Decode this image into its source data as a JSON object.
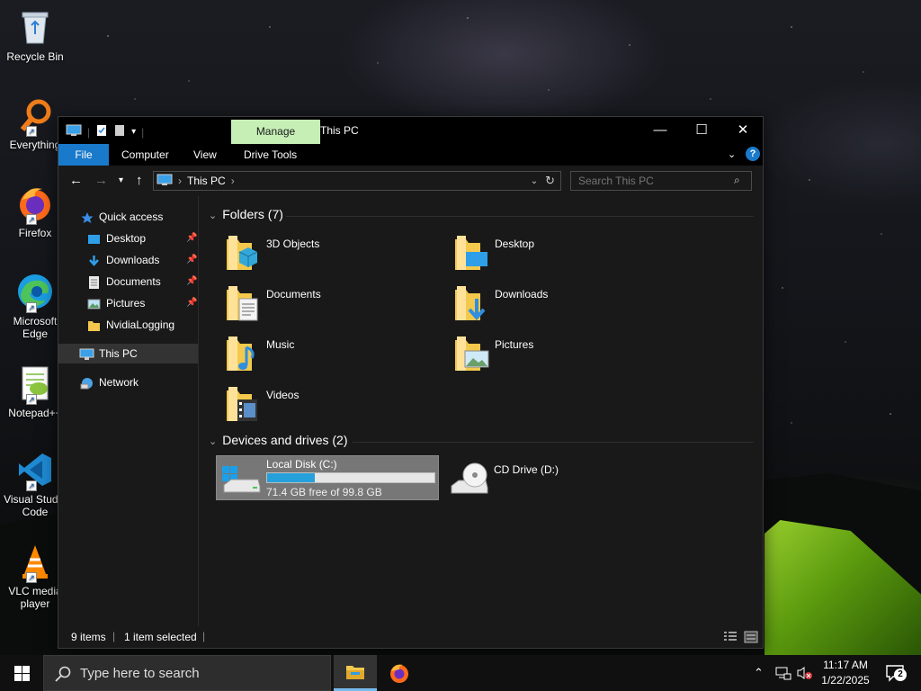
{
  "desktop": {
    "icons": [
      {
        "label": "Recycle Bin",
        "icon": "recycle-bin-icon"
      },
      {
        "label": "Everything",
        "icon": "everything-icon"
      },
      {
        "label": "Firefox",
        "icon": "firefox-icon"
      },
      {
        "label": "Microsoft Edge",
        "icon": "edge-icon"
      },
      {
        "label": "Notepad++",
        "icon": "notepadpp-icon"
      },
      {
        "label": "Visual Studio Code",
        "icon": "vscode-icon"
      },
      {
        "label": "VLC media player",
        "icon": "vlc-icon"
      }
    ]
  },
  "explorer": {
    "title": "This PC",
    "manage_tab": "Manage",
    "ribbon_tabs": [
      "File",
      "Computer",
      "View",
      "Drive Tools"
    ],
    "help": "?",
    "address": {
      "segment": "This PC"
    },
    "search_placeholder": "Search This PC",
    "nav": {
      "quick_access": "Quick access",
      "items": [
        "Desktop",
        "Downloads",
        "Documents",
        "Pictures",
        "NvidiaLogging"
      ],
      "this_pc": "This PC",
      "network": "Network"
    },
    "folders_header": "Folders (7)",
    "folders": [
      "3D Objects",
      "Desktop",
      "Documents",
      "Downloads",
      "Music",
      "Pictures",
      "Videos"
    ],
    "drives_header": "Devices and drives (2)",
    "drives": [
      {
        "name": "Local Disk (C:)",
        "free": "71.4 GB free of 99.8 GB",
        "used_fraction": 0.285
      },
      {
        "name": "CD Drive (D:)"
      }
    ],
    "status": {
      "items": "9 items",
      "selected": "1 item selected"
    }
  },
  "taskbar": {
    "search_placeholder": "Type here to search",
    "time": "11:17 AM",
    "date": "1/22/2025",
    "notifications": "2"
  },
  "colors": {
    "accent": "#1979ca",
    "manage_tab": "#c6efb6",
    "folder": "#f2c94c",
    "bar_fill": "#26a0da"
  }
}
